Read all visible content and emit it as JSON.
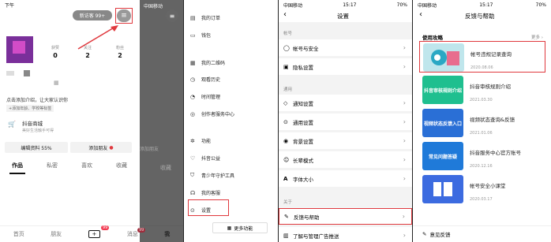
{
  "p1": {
    "time": "下午",
    "new_visitors": "新访客 99+",
    "counts": [
      {
        "label": "获赞",
        "value": "0"
      },
      {
        "label": "关注",
        "value": "2"
      },
      {
        "label": "粉丝",
        "value": "2"
      }
    ],
    "intro": "点击添加介绍，让大家认识你",
    "tags": "+添加年龄、学校等标签",
    "shop_title": "抖音商城",
    "shop_sub": "美好生活触手可得",
    "edit": "编辑资料 55%",
    "add_friend": "添加朋友",
    "tabs": [
      "作品",
      "私密",
      "喜欢",
      "收藏"
    ],
    "nav": [
      "首页",
      "朋友",
      "+",
      "消息",
      "我"
    ],
    "badge": "99"
  },
  "p2": {
    "carrier": "中国移动",
    "items": [
      "我的订单",
      "钱包",
      "我的二维码",
      "观看历史",
      "时间管理",
      "创作者服务中心",
      "功能",
      "抖音公益",
      "青少年守护工具",
      "我的客服",
      "设置"
    ],
    "more": "更多功能",
    "side_friend": "添加朋友",
    "side_tab": "收藏",
    "side_badge": "99"
  },
  "p3": {
    "carrier": "中国移动",
    "time": "15:17",
    "battery": "70%",
    "title": "设置",
    "sec_account": "帐号",
    "sec_general": "通用",
    "sec_about": "关于",
    "rows": [
      "帐号与安全",
      "隐私设置",
      "通知设置",
      "通用设置",
      "背景设置",
      "长辈模式",
      "字体大小",
      "反馈与帮助",
      "了解与管理广告推送"
    ]
  },
  "p4": {
    "carrier": "中国移动",
    "time": "15:17",
    "battery": "70%",
    "title": "反馈与帮助",
    "section": "使用攻略",
    "more": "更多",
    "cards": [
      {
        "title": "帐号违规记录查询",
        "date": "2020.08.06",
        "thumb": ""
      },
      {
        "title": "抖音审核规则介绍",
        "date": "2021.03.30",
        "thumb": "抖音审核规则介绍"
      },
      {
        "title": "视频状态查询&反馈",
        "date": "2021.01.06",
        "thumb": "视频状态反馈入口"
      },
      {
        "title": "抖音服务中心官方账号",
        "date": "2020.12.16",
        "thumb": "常见问题答疑"
      },
      {
        "title": "帐号安全小课堂",
        "date": "2020.03.17",
        "thumb": ""
      }
    ],
    "feedback": "意见反馈"
  },
  "colors": {
    "red": "#e0393e",
    "badge": "#f2384f",
    "purple": "#7a2f9a"
  }
}
